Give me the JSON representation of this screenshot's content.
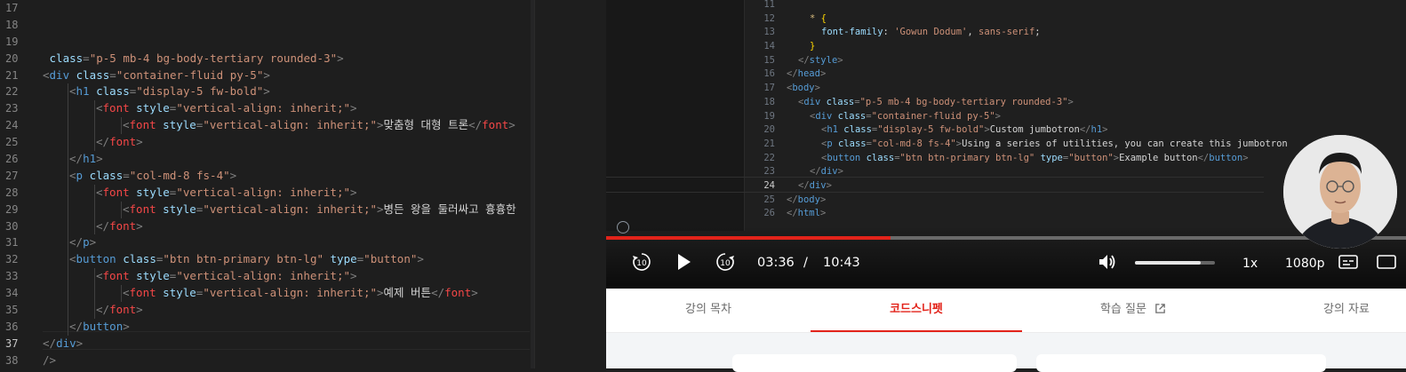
{
  "left_editor": {
    "current_line": "37",
    "lines": [
      {
        "n": "17",
        "tokens": []
      },
      {
        "n": "18",
        "tokens": []
      },
      {
        "n": "19",
        "tokens": []
      },
      {
        "n": "20",
        "indent": 0,
        "tokens": [
          [
            "t-attr",
            " class"
          ],
          [
            "t-punc",
            "="
          ],
          [
            "t-str",
            "\"p-5 mb-4 bg-body-tertiary rounded-3\""
          ],
          [
            "t-punc",
            ">"
          ]
        ]
      },
      {
        "n": "21",
        "indent": 0,
        "tokens": [
          [
            "t-punc",
            "<"
          ],
          [
            "t-tag",
            "div"
          ],
          [
            "t-attr",
            " class"
          ],
          [
            "t-punc",
            "="
          ],
          [
            "t-str",
            "\"container-fluid py-5\""
          ],
          [
            "t-punc",
            ">"
          ]
        ]
      },
      {
        "n": "22",
        "indent": 1,
        "tokens": [
          [
            "t-punc",
            "<"
          ],
          [
            "t-tag",
            "h1"
          ],
          [
            "t-attr",
            " class"
          ],
          [
            "t-punc",
            "="
          ],
          [
            "t-str",
            "\"display-5 fw-bold\""
          ],
          [
            "t-punc",
            ">"
          ]
        ]
      },
      {
        "n": "23",
        "indent": 2,
        "tokens": [
          [
            "t-punc",
            "<"
          ],
          [
            "t-red",
            "font"
          ],
          [
            "t-attr",
            " style"
          ],
          [
            "t-punc",
            "="
          ],
          [
            "t-str",
            "\"vertical-align: inherit;\""
          ],
          [
            "t-punc",
            ">"
          ]
        ]
      },
      {
        "n": "24",
        "indent": 3,
        "tokens": [
          [
            "t-punc",
            "<"
          ],
          [
            "t-red",
            "font"
          ],
          [
            "t-attr",
            " style"
          ],
          [
            "t-punc",
            "="
          ],
          [
            "t-str",
            "\"vertical-align: inherit;\""
          ],
          [
            "t-punc",
            ">"
          ],
          [
            "t-txt",
            "맞춤형 대형 트론"
          ],
          [
            "t-punc",
            "</"
          ],
          [
            "t-red",
            "font"
          ],
          [
            "t-punc",
            ">"
          ]
        ]
      },
      {
        "n": "25",
        "indent": 2,
        "tokens": [
          [
            "t-punc",
            "</"
          ],
          [
            "t-red",
            "font"
          ],
          [
            "t-punc",
            ">"
          ]
        ]
      },
      {
        "n": "26",
        "indent": 1,
        "tokens": [
          [
            "t-punc",
            "</"
          ],
          [
            "t-tag",
            "h1"
          ],
          [
            "t-punc",
            ">"
          ]
        ]
      },
      {
        "n": "27",
        "indent": 1,
        "tokens": [
          [
            "t-punc",
            "<"
          ],
          [
            "t-tag",
            "p"
          ],
          [
            "t-attr",
            " class"
          ],
          [
            "t-punc",
            "="
          ],
          [
            "t-str",
            "\"col-md-8 fs-4\""
          ],
          [
            "t-punc",
            ">"
          ]
        ]
      },
      {
        "n": "28",
        "indent": 2,
        "tokens": [
          [
            "t-punc",
            "<"
          ],
          [
            "t-red",
            "font"
          ],
          [
            "t-attr",
            " style"
          ],
          [
            "t-punc",
            "="
          ],
          [
            "t-str",
            "\"vertical-align: inherit;\""
          ],
          [
            "t-punc",
            ">"
          ]
        ]
      },
      {
        "n": "29",
        "indent": 3,
        "tokens": [
          [
            "t-punc",
            "<"
          ],
          [
            "t-red",
            "font"
          ],
          [
            "t-attr",
            " style"
          ],
          [
            "t-punc",
            "="
          ],
          [
            "t-str",
            "\"vertical-align: inherit;\""
          ],
          [
            "t-punc",
            ">"
          ],
          [
            "t-txt",
            "병든 왕을 둘러싸고 흉흉한"
          ]
        ]
      },
      {
        "n": "30",
        "indent": 2,
        "tokens": [
          [
            "t-punc",
            "</"
          ],
          [
            "t-red",
            "font"
          ],
          [
            "t-punc",
            ">"
          ]
        ]
      },
      {
        "n": "31",
        "indent": 1,
        "tokens": [
          [
            "t-punc",
            "</"
          ],
          [
            "t-tag",
            "p"
          ],
          [
            "t-punc",
            ">"
          ]
        ]
      },
      {
        "n": "32",
        "indent": 1,
        "tokens": [
          [
            "t-punc",
            "<"
          ],
          [
            "t-tag",
            "button"
          ],
          [
            "t-attr",
            " class"
          ],
          [
            "t-punc",
            "="
          ],
          [
            "t-str",
            "\"btn btn-primary btn-lg\""
          ],
          [
            "t-attr",
            " type"
          ],
          [
            "t-punc",
            "="
          ],
          [
            "t-str",
            "\"button\""
          ],
          [
            "t-punc",
            ">"
          ]
        ]
      },
      {
        "n": "33",
        "indent": 2,
        "tokens": [
          [
            "t-punc",
            "<"
          ],
          [
            "t-red",
            "font"
          ],
          [
            "t-attr",
            " style"
          ],
          [
            "t-punc",
            "="
          ],
          [
            "t-str",
            "\"vertical-align: inherit;\""
          ],
          [
            "t-punc",
            ">"
          ]
        ]
      },
      {
        "n": "34",
        "indent": 3,
        "tokens": [
          [
            "t-punc",
            "<"
          ],
          [
            "t-red",
            "font"
          ],
          [
            "t-attr",
            " style"
          ],
          [
            "t-punc",
            "="
          ],
          [
            "t-str",
            "\"vertical-align: inherit;\""
          ],
          [
            "t-punc",
            ">"
          ],
          [
            "t-txt",
            "예제 버튼"
          ],
          [
            "t-punc",
            "</"
          ],
          [
            "t-red",
            "font"
          ],
          [
            "t-punc",
            ">"
          ]
        ]
      },
      {
        "n": "35",
        "indent": 2,
        "tokens": [
          [
            "t-punc",
            "</"
          ],
          [
            "t-red",
            "font"
          ],
          [
            "t-punc",
            ">"
          ]
        ]
      },
      {
        "n": "36",
        "indent": 1,
        "tokens": [
          [
            "t-punc",
            "</"
          ],
          [
            "t-tag",
            "button"
          ],
          [
            "t-punc",
            ">"
          ]
        ]
      },
      {
        "n": "37",
        "indent": 0,
        "tokens": [
          [
            "t-punc",
            "</"
          ],
          [
            "t-tag",
            "div"
          ],
          [
            "t-punc",
            ">"
          ]
        ]
      },
      {
        "n": "38",
        "indent": 0,
        "tokens": [
          [
            "t-punc",
            "/>"
          ]
        ]
      }
    ]
  },
  "video": {
    "current_line": "24",
    "lines": [
      {
        "n": "11",
        "indent": 0,
        "tokens": []
      },
      {
        "n": "12",
        "indent": 2,
        "tokens": [
          [
            "t-sel",
            "* "
          ],
          [
            "t-brace",
            "{"
          ]
        ]
      },
      {
        "n": "13",
        "indent": 3,
        "tokens": [
          [
            "t-prop",
            "font-family"
          ],
          [
            "t-txt",
            ": "
          ],
          [
            "t-str",
            "'Gowun Dodum'"
          ],
          [
            "t-txt",
            ", "
          ],
          [
            "t-str",
            "sans-serif"
          ],
          [
            "t-txt",
            ";"
          ]
        ]
      },
      {
        "n": "14",
        "indent": 2,
        "tokens": [
          [
            "t-brace",
            "}"
          ]
        ]
      },
      {
        "n": "15",
        "indent": 1,
        "tokens": [
          [
            "t-punc",
            "</"
          ],
          [
            "t-tag",
            "style"
          ],
          [
            "t-punc",
            ">"
          ]
        ]
      },
      {
        "n": "16",
        "indent": 0,
        "tokens": [
          [
            "t-punc",
            "</"
          ],
          [
            "t-tag",
            "head"
          ],
          [
            "t-punc",
            ">"
          ]
        ]
      },
      {
        "n": "17",
        "indent": 0,
        "tokens": [
          [
            "t-punc",
            "<"
          ],
          [
            "t-tag",
            "body"
          ],
          [
            "t-punc",
            ">"
          ]
        ]
      },
      {
        "n": "18",
        "indent": 1,
        "tokens": [
          [
            "t-punc",
            "<"
          ],
          [
            "t-tag",
            "div"
          ],
          [
            "t-attr",
            " class"
          ],
          [
            "t-punc",
            "="
          ],
          [
            "t-str",
            "\"p-5 mb-4 bg-body-tertiary rounded-3\""
          ],
          [
            "t-punc",
            ">"
          ]
        ]
      },
      {
        "n": "19",
        "indent": 2,
        "tokens": [
          [
            "t-punc",
            "<"
          ],
          [
            "t-tag",
            "div"
          ],
          [
            "t-attr",
            " class"
          ],
          [
            "t-punc",
            "="
          ],
          [
            "t-str",
            "\"container-fluid py-5\""
          ],
          [
            "t-punc",
            ">"
          ]
        ]
      },
      {
        "n": "20",
        "indent": 3,
        "tokens": [
          [
            "t-punc",
            "<"
          ],
          [
            "t-tag",
            "h1"
          ],
          [
            "t-attr",
            " class"
          ],
          [
            "t-punc",
            "="
          ],
          [
            "t-str",
            "\"display-5 fw-bold\""
          ],
          [
            "t-punc",
            ">"
          ],
          [
            "t-txt",
            "Custom jumbotron"
          ],
          [
            "t-punc",
            "</"
          ],
          [
            "t-tag",
            "h1"
          ],
          [
            "t-punc",
            ">"
          ]
        ]
      },
      {
        "n": "21",
        "indent": 3,
        "tokens": [
          [
            "t-punc",
            "<"
          ],
          [
            "t-tag",
            "p"
          ],
          [
            "t-attr",
            " class"
          ],
          [
            "t-punc",
            "="
          ],
          [
            "t-str",
            "\"col-md-8 fs-4\""
          ],
          [
            "t-punc",
            ">"
          ],
          [
            "t-txt",
            "Using a series of utilities, you can create this jumbotron"
          ]
        ]
      },
      {
        "n": "22",
        "indent": 3,
        "tokens": [
          [
            "t-punc",
            "<"
          ],
          [
            "t-tag",
            "button"
          ],
          [
            "t-attr",
            " class"
          ],
          [
            "t-punc",
            "="
          ],
          [
            "t-str",
            "\"btn btn-primary btn-lg\""
          ],
          [
            "t-attr",
            " type"
          ],
          [
            "t-punc",
            "="
          ],
          [
            "t-str",
            "\"button\""
          ],
          [
            "t-punc",
            ">"
          ],
          [
            "t-txt",
            "Example button"
          ],
          [
            "t-punc",
            "</"
          ],
          [
            "t-tag",
            "button"
          ],
          [
            "t-punc",
            ">"
          ]
        ]
      },
      {
        "n": "23",
        "indent": 2,
        "tokens": [
          [
            "t-punc",
            "</"
          ],
          [
            "t-tag",
            "div"
          ],
          [
            "t-punc",
            ">"
          ]
        ]
      },
      {
        "n": "24",
        "indent": 1,
        "tokens": [
          [
            "t-punc",
            "</"
          ],
          [
            "t-tag",
            "div"
          ],
          [
            "t-punc",
            ">"
          ]
        ]
      },
      {
        "n": "25",
        "indent": 0,
        "tokens": [
          [
            "t-punc",
            "</"
          ],
          [
            "t-tag",
            "body"
          ],
          [
            "t-punc",
            ">"
          ]
        ]
      },
      {
        "n": "26",
        "indent": 0,
        "tokens": [
          [
            "t-punc",
            "</"
          ],
          [
            "t-tag",
            "html"
          ],
          [
            "t-punc",
            ">"
          ]
        ]
      }
    ],
    "controls": {
      "rewind_label": "10",
      "forward_label": "10",
      "current_time": "03:36",
      "time_separator": "/",
      "duration": "10:43",
      "speed": "1x",
      "quality": "1080p",
      "progress": 0.356,
      "volume": 0.82
    },
    "colors": {
      "progress": "#e2231a",
      "accent_red": "#e2231a"
    }
  },
  "tabs": [
    {
      "label": "강의 목차",
      "active": false
    },
    {
      "label": "코드스니펫",
      "active": true
    },
    {
      "label": "학습 질문",
      "active": false,
      "external": true
    },
    {
      "label": "강의 자료",
      "active": false
    }
  ]
}
